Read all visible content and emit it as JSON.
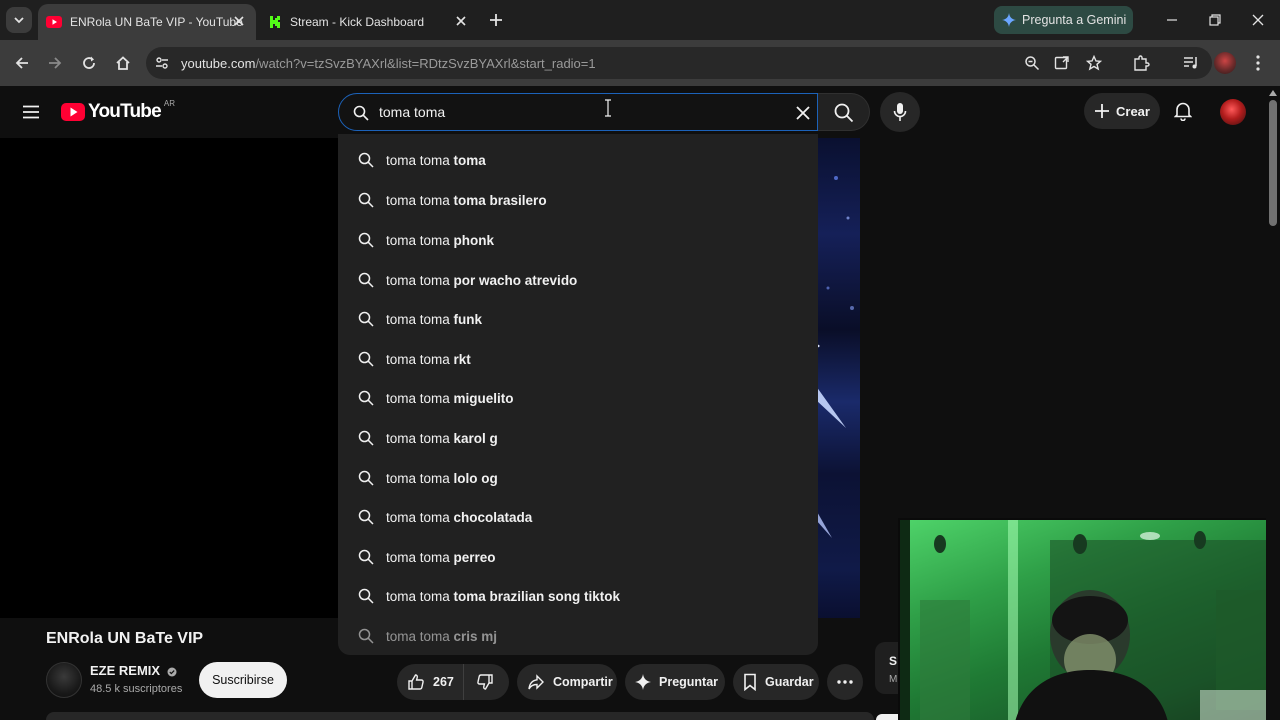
{
  "browser": {
    "tabs": [
      {
        "title": "ENRola UN BaTe VIP - YouTube",
        "active": true
      },
      {
        "title": "Stream - Kick Dashboard",
        "active": false
      }
    ],
    "gemini_label": "Pregunta a Gemini",
    "url_host": "youtube.com",
    "url_path": "/watch?v=tzSvzBYAXrl&list=RDtzSvzBYAXrl&start_radio=1"
  },
  "youtube": {
    "logo_text": "YouTube",
    "region": "AR",
    "search_value": "toma toma",
    "create_label": "Crear"
  },
  "suggestions": [
    {
      "prefix": "toma toma ",
      "rest": "toma"
    },
    {
      "prefix": "toma toma ",
      "rest": "toma brasilero"
    },
    {
      "prefix": "toma toma ",
      "rest": "phonk"
    },
    {
      "prefix": "toma toma ",
      "rest": "por wacho atrevido"
    },
    {
      "prefix": "toma toma ",
      "rest": "funk"
    },
    {
      "prefix": "toma toma ",
      "rest": "rkt"
    },
    {
      "prefix": "toma toma ",
      "rest": "miguelito"
    },
    {
      "prefix": "toma toma ",
      "rest": "karol g"
    },
    {
      "prefix": "toma toma ",
      "rest": "lolo og"
    },
    {
      "prefix": "toma toma ",
      "rest": "chocolatada"
    },
    {
      "prefix": "toma toma ",
      "rest": "perreo"
    },
    {
      "prefix": "toma toma ",
      "rest": "toma brazilian song tiktok"
    },
    {
      "prefix": "toma toma ",
      "rest": "cris mj"
    }
  ],
  "video": {
    "title": "ENRola UN BaTe VIP",
    "channel": "EZE REMIX",
    "subscribers": "48.5 k suscriptores",
    "subscribe_label": "Suscribirse",
    "likes": "267",
    "share_label": "Compartir",
    "ask_label": "Preguntar",
    "save_label": "Guardar"
  },
  "side_peek": {
    "line1": "S",
    "line2": "M"
  }
}
